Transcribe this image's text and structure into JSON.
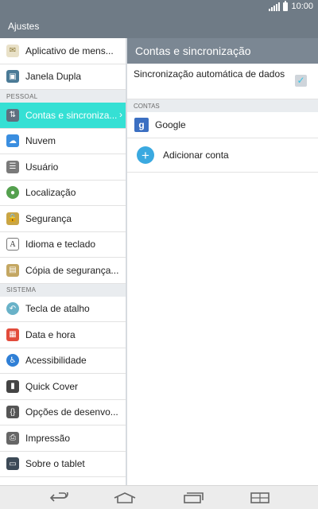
{
  "status": {
    "time": "10:00"
  },
  "app": {
    "title": "Ajustes"
  },
  "left": {
    "items": [
      {
        "label": "Aplicativo de mens..."
      },
      {
        "label": "Janela Dupla"
      },
      {
        "label": "Contas e sincroniza..."
      },
      {
        "label": "Nuvem"
      },
      {
        "label": "Usuário"
      },
      {
        "label": "Localização"
      },
      {
        "label": "Segurança"
      },
      {
        "label": "Idioma e teclado"
      },
      {
        "label": "Cópia de segurança..."
      },
      {
        "label": "Tecla de atalho"
      },
      {
        "label": "Data e hora"
      },
      {
        "label": "Acessibilidade"
      },
      {
        "label": "Quick Cover"
      },
      {
        "label": "Opções de desenvo..."
      },
      {
        "label": "Impressão"
      },
      {
        "label": "Sobre o tablet"
      }
    ],
    "sections": {
      "pessoal": "PESSOAL",
      "sistema": "SISTEMA"
    }
  },
  "right": {
    "title": "Contas e sincronização",
    "sync_label": "Sincronização automática de dados",
    "sync_checked": true,
    "section_label": "CONTAS",
    "google_label": "Google",
    "add_label": "Adicionar conta"
  },
  "icons": {
    "accent": "#35e0d4",
    "header": "#6f7b86"
  }
}
